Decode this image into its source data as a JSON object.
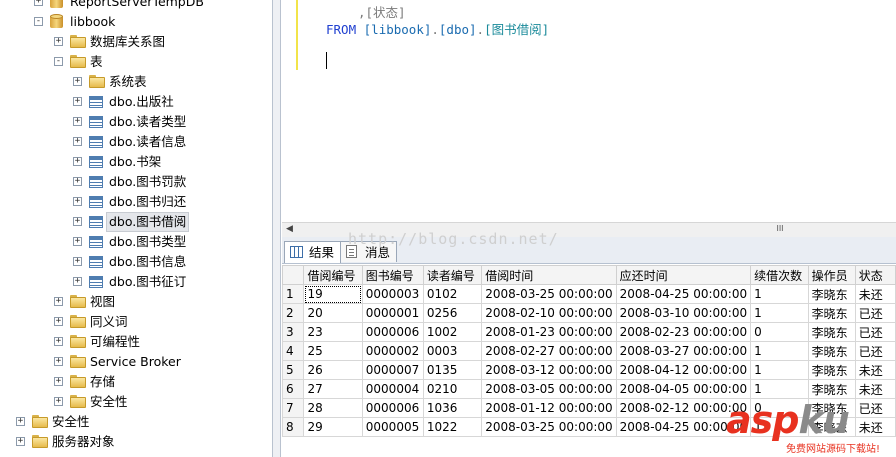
{
  "explorer": {
    "items": [
      {
        "label": "ReportServerTempDB",
        "icon": "database-icon",
        "state": "+",
        "level": 1
      },
      {
        "label": "libbook",
        "icon": "database-icon",
        "state": "-",
        "level": 1
      },
      {
        "label": "数据库关系图",
        "icon": "folder-icon",
        "state": "+",
        "level": 2
      },
      {
        "label": "表",
        "icon": "folder-icon",
        "state": "-",
        "level": 2
      },
      {
        "label": "系统表",
        "icon": "folder-icon",
        "state": "+",
        "level": 3
      },
      {
        "label": "dbo.出版社",
        "icon": "table-icon",
        "state": "+",
        "level": 3
      },
      {
        "label": "dbo.读者类型",
        "icon": "table-icon",
        "state": "+",
        "level": 3
      },
      {
        "label": "dbo.读者信息",
        "icon": "table-icon",
        "state": "+",
        "level": 3
      },
      {
        "label": "dbo.书架",
        "icon": "table-icon",
        "state": "+",
        "level": 3
      },
      {
        "label": "dbo.图书罚款",
        "icon": "table-icon",
        "state": "+",
        "level": 3
      },
      {
        "label": "dbo.图书归还",
        "icon": "table-icon",
        "state": "+",
        "level": 3
      },
      {
        "label": "dbo.图书借阅",
        "icon": "table-icon",
        "state": "+",
        "level": 3,
        "selected": true
      },
      {
        "label": "dbo.图书类型",
        "icon": "table-icon",
        "state": "+",
        "level": 3
      },
      {
        "label": "dbo.图书信息",
        "icon": "table-icon",
        "state": "+",
        "level": 3
      },
      {
        "label": "dbo.图书征订",
        "icon": "table-icon",
        "state": "+",
        "level": 3
      },
      {
        "label": "视图",
        "icon": "folder-icon",
        "state": "+",
        "level": 2
      },
      {
        "label": "同义词",
        "icon": "folder-icon",
        "state": "+",
        "level": 2
      },
      {
        "label": "可编程性",
        "icon": "folder-icon",
        "state": "+",
        "level": 2
      },
      {
        "label": "Service Broker",
        "icon": "folder-icon",
        "state": "+",
        "level": 2
      },
      {
        "label": "存储",
        "icon": "folder-icon",
        "state": "+",
        "level": 2
      },
      {
        "label": "安全性",
        "icon": "folder-icon",
        "state": "+",
        "level": 2
      },
      {
        "label": "安全性",
        "icon": "folder-icon",
        "state": "+",
        "level": 0
      },
      {
        "label": "服务器对象",
        "icon": "folder-icon",
        "state": "+",
        "level": 0
      }
    ]
  },
  "editor": {
    "line1": ",[状态]",
    "line2_kw": "FROM",
    "line2_db": "[libbook]",
    "line2_dot1": ".",
    "line2_schema": "[dbo]",
    "line2_dot2": ".",
    "line2_table": "[图书借阅]",
    "scroll_glyph": "III"
  },
  "results": {
    "tabs": [
      {
        "label": "结果",
        "icon": "grid-icon",
        "active": true
      },
      {
        "label": "消息",
        "icon": "message-icon",
        "active": false
      }
    ],
    "watermark": "http://blog.csdn.net/",
    "columns": [
      "借阅编号",
      "图书编号",
      "读者编号",
      "借阅时间",
      "应还时间",
      "续借次数",
      "操作员",
      "状态"
    ],
    "rows": [
      [
        "1",
        "19",
        "0000003",
        "0102",
        "2008-03-25 00:00:00",
        "2008-04-25 00:00:00",
        "1",
        "李晓东",
        "未还"
      ],
      [
        "2",
        "20",
        "0000001",
        "0256",
        "2008-02-10 00:00:00",
        "2008-03-10 00:00:00",
        "1",
        "李晓东",
        "已还"
      ],
      [
        "3",
        "23",
        "0000006",
        "1002",
        "2008-01-23 00:00:00",
        "2008-02-23 00:00:00",
        "0",
        "李晓东",
        "已还"
      ],
      [
        "4",
        "25",
        "0000002",
        "0003",
        "2008-02-27 00:00:00",
        "2008-03-27 00:00:00",
        "1",
        "李晓东",
        "已还"
      ],
      [
        "5",
        "26",
        "0000007",
        "0135",
        "2008-03-12 00:00:00",
        "2008-04-12 00:00:00",
        "1",
        "李晓东",
        "未还"
      ],
      [
        "6",
        "27",
        "0000004",
        "0210",
        "2008-03-05 00:00:00",
        "2008-04-05 00:00:00",
        "1",
        "李晓东",
        "未还"
      ],
      [
        "7",
        "28",
        "0000006",
        "1036",
        "2008-01-12 00:00:00",
        "2008-02-12 00:00:00",
        "0",
        "李晓东",
        "已还"
      ],
      [
        "8",
        "29",
        "0000005",
        "1022",
        "2008-03-25 00:00:00",
        "2008-04-25 00:00:00",
        "1",
        "李晓东",
        "未还"
      ]
    ]
  },
  "logo": {
    "main": "asp",
    "suffix": "ku",
    "tagline": "免费网站源码下载站!",
    "color": "#e8311f"
  }
}
